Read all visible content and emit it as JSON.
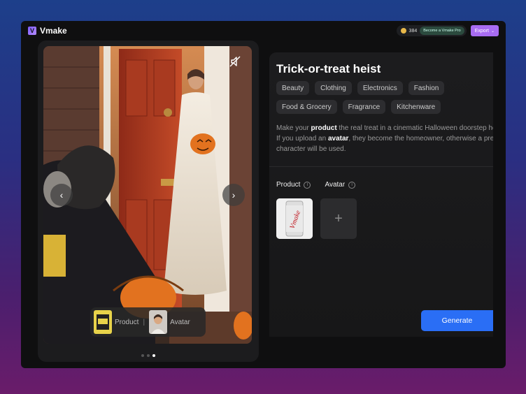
{
  "app": {
    "name": "Vmake",
    "logo_glyph": "V"
  },
  "topbar": {
    "credits": "384",
    "pro_label": "Become a Vmake Pro",
    "export_label": "Export",
    "export_chevron": "⌄"
  },
  "media": {
    "mute_icon": "mute-icon",
    "prev_glyph": "‹",
    "next_glyph": "›",
    "chips": {
      "product_label": "Product",
      "divider": "|",
      "avatar_label": "Avatar"
    },
    "dots": 3,
    "active_dot": 2
  },
  "detail": {
    "title": "Trick-or-treat heist",
    "tags": [
      "Beauty",
      "Clothing",
      "Electronics",
      "Fashion",
      "Food & Grocery",
      "Fragrance",
      "Kitchenware"
    ],
    "description": {
      "line1_pre": "Make your ",
      "line1_bold": "product",
      "line1_post": " the real treat in a cinematic Halloween doorstep he",
      "line2_pre": "If you upload an ",
      "line2_bold": "avatar",
      "line2_post": ", they become the homeowner, otherwise a pre",
      "line3": "character will be used."
    },
    "product_label": "Product",
    "avatar_label": "Avatar",
    "info_glyph": "i",
    "add_glyph": "+",
    "product_can_text": "Vmake",
    "generate_label": "Generate"
  },
  "colors": {
    "accent": "#2a6ef5",
    "export": "#a86cf2"
  }
}
